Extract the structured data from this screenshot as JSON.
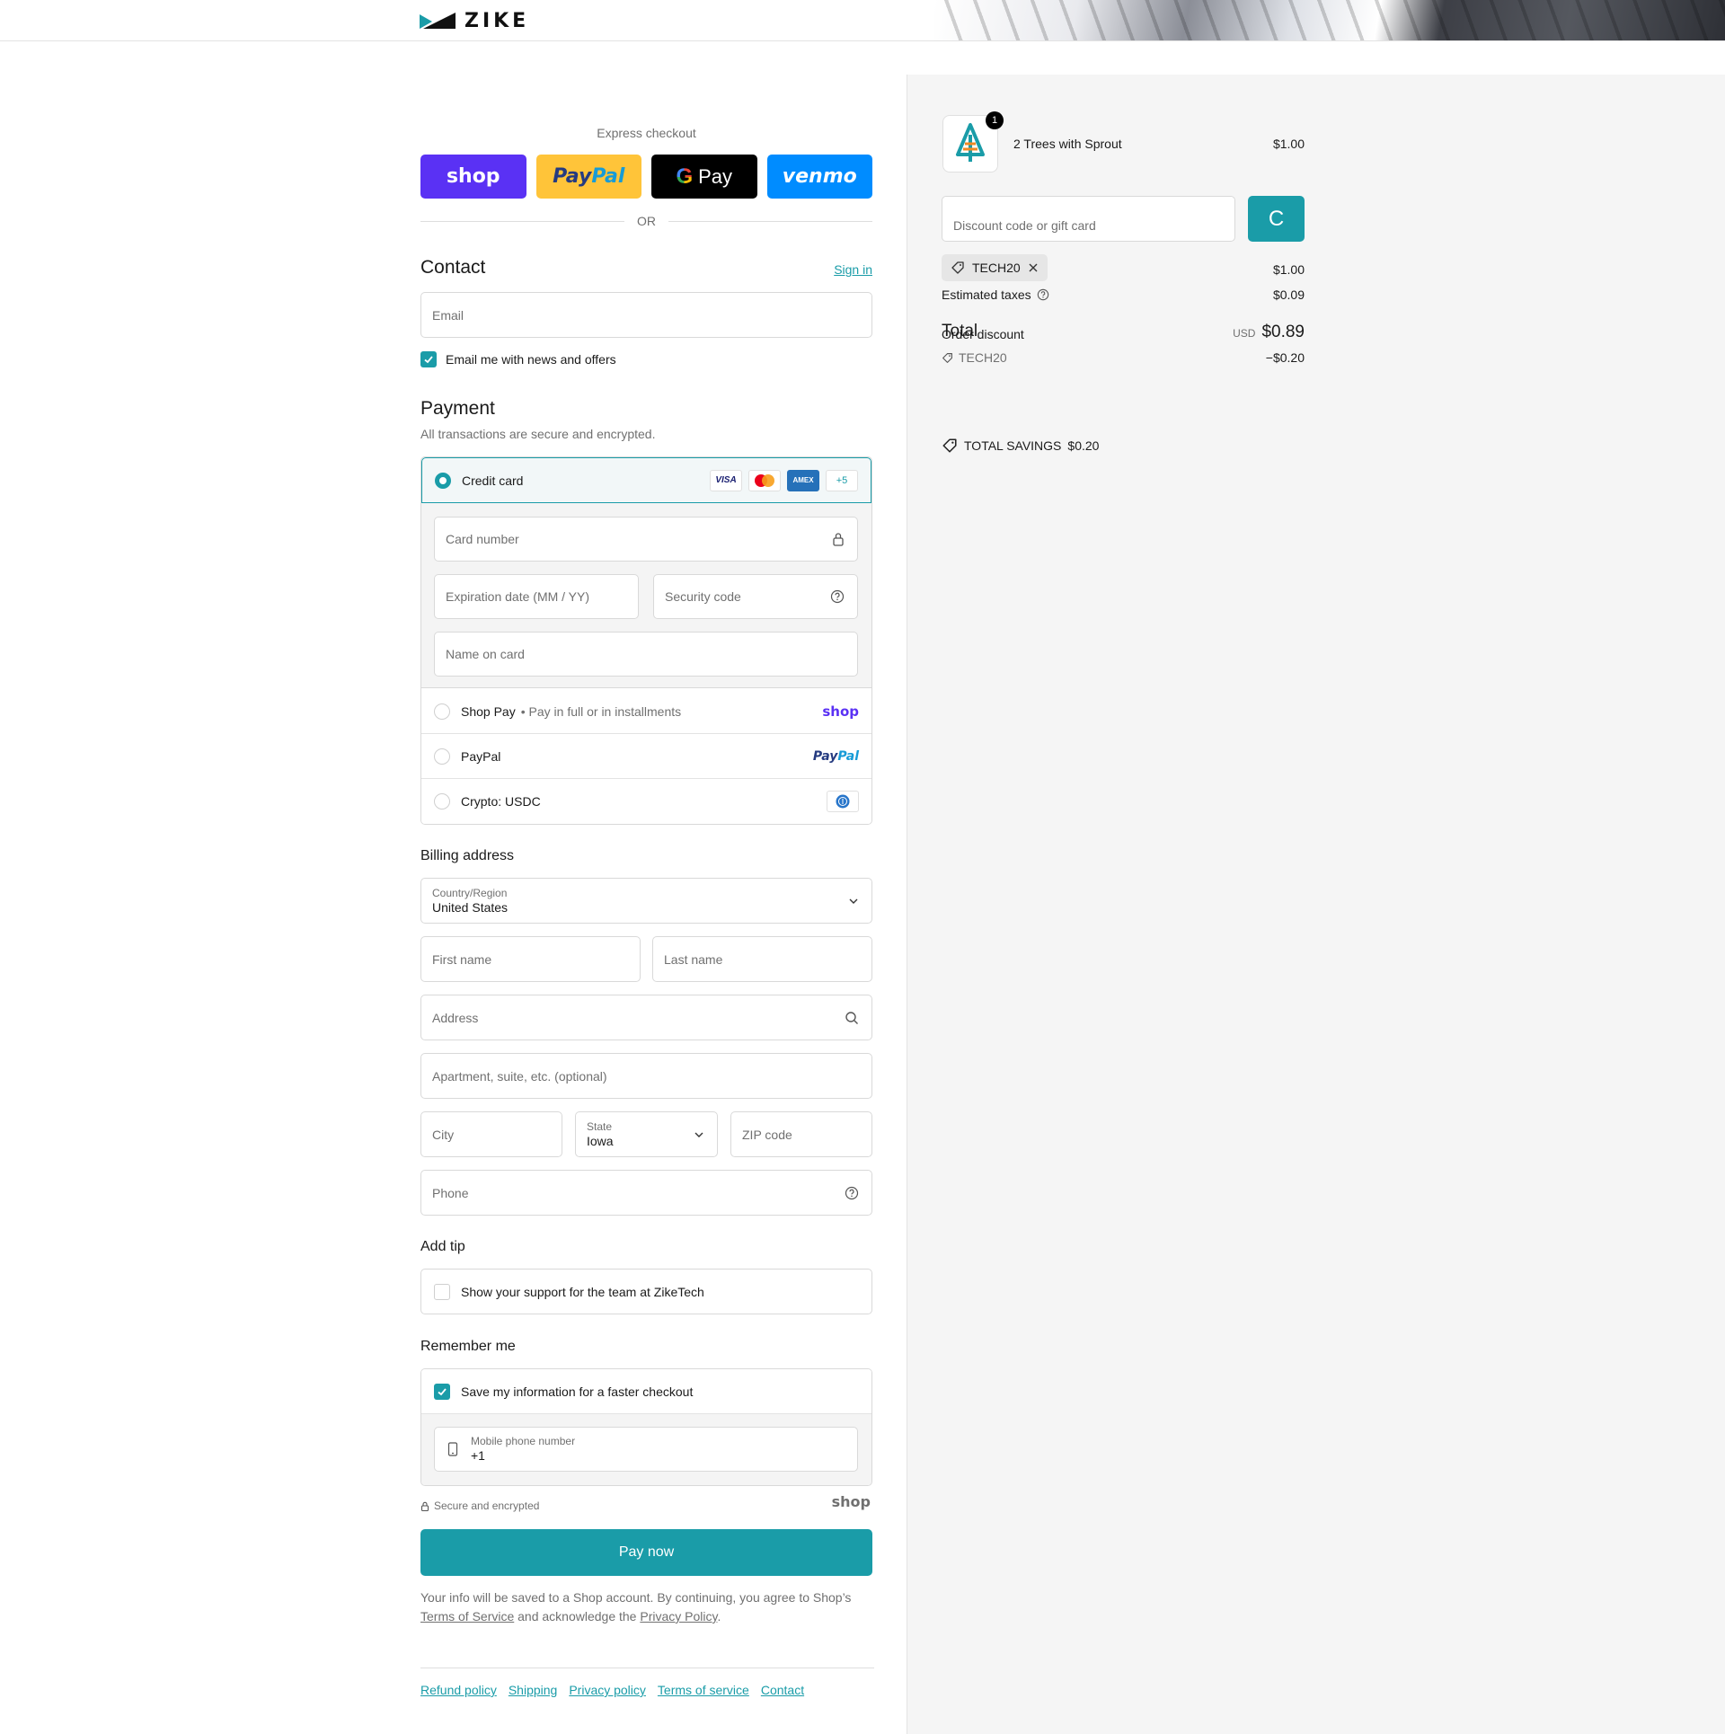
{
  "header": {
    "logo_text": "ZIKE"
  },
  "express": {
    "title": "Express checkout",
    "buttons": {
      "shop": "shop",
      "paypal_a": "Pay",
      "paypal_b": "Pal",
      "gpay_g": "G",
      "gpay_text": "Pay",
      "venmo": "venmo"
    },
    "or": "OR"
  },
  "contact": {
    "heading": "Contact",
    "sign_in": "Sign in",
    "email_placeholder": "Email",
    "news_label": "Email me with news and offers",
    "news_checked": true
  },
  "payment": {
    "heading": "Payment",
    "subtitle": "All transactions are secure and encrypted.",
    "credit_card": {
      "label": "Credit card",
      "brands": [
        "VISA",
        "",
        "AMEX",
        "+5"
      ],
      "card_number": "Card number",
      "expiration": "Expiration date (MM / YY)",
      "security": "Security code",
      "name_on_card": "Name on card"
    },
    "shop_pay": {
      "label": "Shop Pay",
      "sub": "Pay in full or in installments",
      "logo": "shop"
    },
    "paypal": {
      "label": "PayPal",
      "logo_a": "Pay",
      "logo_b": "Pal"
    },
    "crypto": {
      "label": "Crypto: USDC"
    }
  },
  "billing": {
    "heading": "Billing address",
    "country_label": "Country/Region",
    "country_value": "United States",
    "first_name": "First name",
    "last_name": "Last name",
    "address": "Address",
    "apartment": "Apartment, suite, etc. (optional)",
    "city": "City",
    "state_label": "State",
    "state_value": "Iowa",
    "zip": "ZIP code",
    "phone": "Phone"
  },
  "tip": {
    "heading": "Add tip",
    "label": "Show your support for the team at ZikeTech"
  },
  "remember": {
    "heading": "Remember me",
    "label": "Save my information for a faster checkout",
    "mobile_label": "Mobile phone number",
    "mobile_value": "+1"
  },
  "secure": {
    "text": "Secure and encrypted",
    "logo": "shop"
  },
  "pay_now": "Pay now",
  "legal": {
    "part1": "Your info will be saved to a Shop account. By continuing, you agree to Shop’s",
    "terms": "Terms of Service",
    "part2": "and acknowledge the",
    "privacy": "Privacy Policy",
    "end": "."
  },
  "footer_links": [
    "Refund policy",
    "Shipping",
    "Privacy policy",
    "Terms of service",
    "Contact"
  ],
  "summary": {
    "item": {
      "name": "2 Trees with Sprout",
      "price": "$1.00",
      "quantity": "1"
    },
    "discount_placeholder": "Discount code or gift card",
    "apply_glyph": "C",
    "code": "TECH20",
    "subtotal": "$1.00",
    "taxes_label": "Estimated taxes",
    "taxes": "$0.09",
    "total_label": "Total",
    "order_discount_label": "Order discount",
    "currency": "USD",
    "total": "$0.89",
    "discount_code": "TECH20",
    "discount_amount": "−$0.20",
    "savings_label": "TOTAL SAVINGS",
    "savings_amount": "$0.20"
  },
  "colors": {
    "accent": "#1a9ca8",
    "shop": "#5a31f4",
    "paypal": "#ffc439",
    "venmo": "#008cff"
  }
}
